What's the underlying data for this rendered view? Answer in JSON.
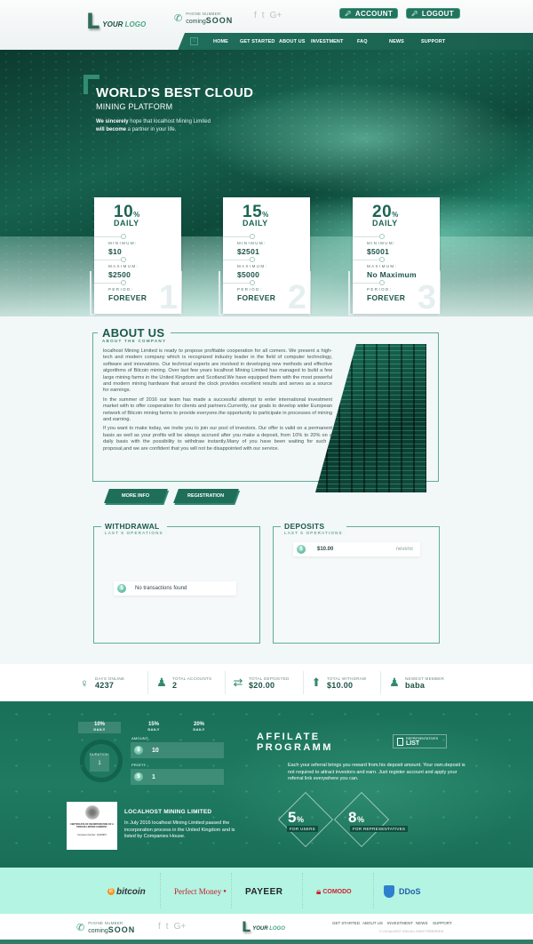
{
  "header": {
    "logo": {
      "letter": "L",
      "text_a": "YOUR",
      "text_b": "LOGO"
    },
    "phone": {
      "label": "PHONE NUMBER:",
      "value_prefix": "coming",
      "value_main": "SOON"
    },
    "social": [
      "f",
      "t",
      "G+"
    ],
    "account_button": "ACCOUNT",
    "logout_button": "LOGOUT"
  },
  "nav": {
    "items": [
      "HOME",
      "GET STARTED",
      "ABOUT US",
      "INVESTMENT",
      "FAQ",
      "NEWS",
      "SUPPORT"
    ]
  },
  "hero": {
    "title": "WORLD'S BEST CLOUD",
    "subtitle": "MINING PLATFORM",
    "desc_bold_1": "We sincerely",
    "desc_1": " hope that localhost Mining Limited",
    "desc_bold_2": "will become",
    "desc_2": " a partner in your life."
  },
  "plans": [
    {
      "percent": "10",
      "pct_sign": "%",
      "period_label": "DAILY",
      "minimum_label": "MINIMUM:",
      "minimum": "$10",
      "maximum_label": "MAXIMUM:",
      "maximum": "$2500",
      "duration_label": "PERIOD:",
      "duration": "FOREVER",
      "number": "1"
    },
    {
      "percent": "15",
      "pct_sign": "%",
      "period_label": "DAILY",
      "minimum_label": "MINIMUM:",
      "minimum": "$2501",
      "maximum_label": "MAXIMUM:",
      "maximum": "$5000",
      "duration_label": "PERIOD:",
      "duration": "FOREVER",
      "number": "2"
    },
    {
      "percent": "20",
      "pct_sign": "%",
      "period_label": "DAILY",
      "minimum_label": "MINIMUM:",
      "minimum": "$5001",
      "maximum_label": "MAXIMUM:",
      "maximum": "No Maximum",
      "duration_label": "PERIOD:",
      "duration": "FOREVER",
      "number": "3"
    }
  ],
  "about": {
    "title": "ABOUT US",
    "subtitle": "ABOUT THE COMPANY",
    "paragraphs": [
      "localhost Mining Limited is ready to propose profitable cooperation for all comers. We present a high-tech and modern company which is recognized industry leader in the field of computer technology, software and innovations. Our technical experts are involved in developing new methods and effective algorithms of Bitcoin mining. Over last few years localhost Mining Limited has managed to build a few large mining farms in the United Kingdom and Scotland.We have equipped them with the most powerful and modern mining hardware that around the clock provides excellent results and serves as a source for earnings.",
      "In the summer of 2016 our team has made a successful attempt to enter international investment market with to offer cooperation for clients and partners.Currently, our goals to develop wider European network of Bitcoin mining farms to provide everyone.the opportunity to participate in processes of mining and earning.",
      "If you want to make today, we invite you to join our pool of investors. Our offer is valid on a permanent basis as well as your profits will be always accrued after you make a deposit, from 10% to 20% on a daily basis with the possibility to withdraw instantly.Many of you have been waiting for such a proposal,and we are confident that you will not be disappointed with our service."
    ],
    "more_info_button": "MORE INFO",
    "registration_button": "REGISTRATION"
  },
  "withdrawal": {
    "title": "WITHDRAWAL",
    "subtitle": "LAST 5 OPERATIONS",
    "empty_message": "No transactions found"
  },
  "deposits": {
    "title": "DEPOSITS",
    "subtitle": "LAST 5 OPERATIONS",
    "items": [
      {
        "amount": "$10.00",
        "user": "nevenx"
      }
    ]
  },
  "stats": [
    {
      "label": "DAYS ONLINE",
      "value": "4237",
      "icon": "globe-icon"
    },
    {
      "label": "TOTAL ACCOUNTS",
      "value": "2",
      "icon": "users-icon"
    },
    {
      "label": "TOTAL DEPOSITED",
      "value": "$20.00",
      "icon": "deposit-icon"
    },
    {
      "label": "TOTAL WITHDRAW",
      "value": "$10.00",
      "icon": "withdraw-icon"
    },
    {
      "label": "NEWEST MEMBER",
      "value": "baba",
      "icon": "member-icon"
    }
  ],
  "calculator": {
    "tabs": [
      {
        "pct": "10%",
        "label": "DAILY"
      },
      {
        "pct": "15%",
        "label": "DAILY"
      },
      {
        "pct": "20%",
        "label": "DAILY"
      }
    ],
    "duration_label": "DURATION:",
    "duration": "1",
    "amount_label": "AMOUNT:",
    "amount": "10",
    "profit_label": "PROFIT:",
    "profit": "1"
  },
  "affiliate": {
    "title_1": "AFFILATE",
    "title_2": "PROGRAMM",
    "rep_list_top": "REPRESENTATIVES",
    "rep_list_bottom": "LIST",
    "description": "Each your referral brings you reward from his deposit amount. Your own deposit is not required to attract investors and earn. Just register account and apply your referral link everywhere you can.",
    "users_pct": "5",
    "users_label": "FOR USERS",
    "reps_pct": "8",
    "reps_label": "FOR REPRESENTATIVES",
    "pct_sign": "%"
  },
  "company": {
    "cert_title": "CERTIFICATE OF INCORPORATION OF A PRIVATE LIMITED COMPANY",
    "cert_number": "Company Number: 10429697",
    "title": "LOCALHOST MINING LIMITED",
    "description": "In July 2016 localhost Mining Limited passed the incorporation process in the United Kingdom and is listed by Companies House."
  },
  "payments": [
    "bitcoin",
    "Perfect Money",
    "PAYEER",
    "COMODO",
    "DDoS"
  ],
  "footer": {
    "phone_label": "PHONE NUMBER:",
    "phone_prefix": "coming",
    "phone_main": "SOON",
    "links": [
      "GET STARTED",
      "ABOUT US",
      "INVESTMENT",
      "NEWS",
      "SUPPORT"
    ],
    "copyright": "© LOCALHOST 2016 ALL RIGHT RESERVED"
  },
  "colors": {
    "primary": "#1f6e5a",
    "accent": "#3a9e7f",
    "mint": "#b3f4e3"
  }
}
